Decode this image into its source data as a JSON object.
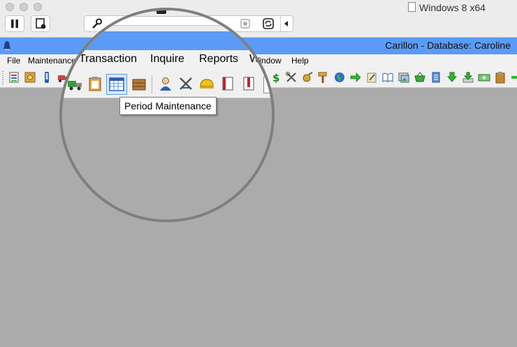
{
  "host": {
    "window_title": "Windows 8 x64",
    "icons": [
      "pause-icon",
      "snapshot-icon",
      "wrench-icon",
      "camera-icon",
      "record-icon",
      "sync-icon",
      "collapse-arrow-icon"
    ]
  },
  "app": {
    "title": "Carillon - Database: Caroline",
    "menu": [
      "File",
      "Maintenance",
      "Transaction",
      "Inquire",
      "Reports",
      "Window",
      "Help"
    ]
  },
  "magnified": {
    "menu": [
      "Transaction",
      "Inquire",
      "Reports",
      "Window"
    ],
    "tooltip": "Period Maintenance"
  },
  "toolbar": {
    "icons": [
      "report-icon",
      "safe-icon",
      "phone-icon",
      "truck-icon",
      "clipboard-icon",
      "calendar-icon",
      "box-icon",
      "person-icon",
      "tools-icon",
      "hardhat-icon",
      "book-icon",
      "book-red-icon",
      "dollar-icon",
      "wrench-screwdriver-icon",
      "tape-icon",
      "hammer-icon",
      "globe-icon",
      "arrow-right-icon",
      "pencil-note-icon",
      "open-book-icon",
      "image-icon",
      "basket-icon",
      "scroll-icon",
      "download-green-icon",
      "download-green2-icon",
      "money-icon",
      "clipboard-brown-icon",
      "arrow-green-icon"
    ]
  },
  "colors": {
    "titlebar": "#5b9bf6",
    "workspace": "#ababab"
  }
}
